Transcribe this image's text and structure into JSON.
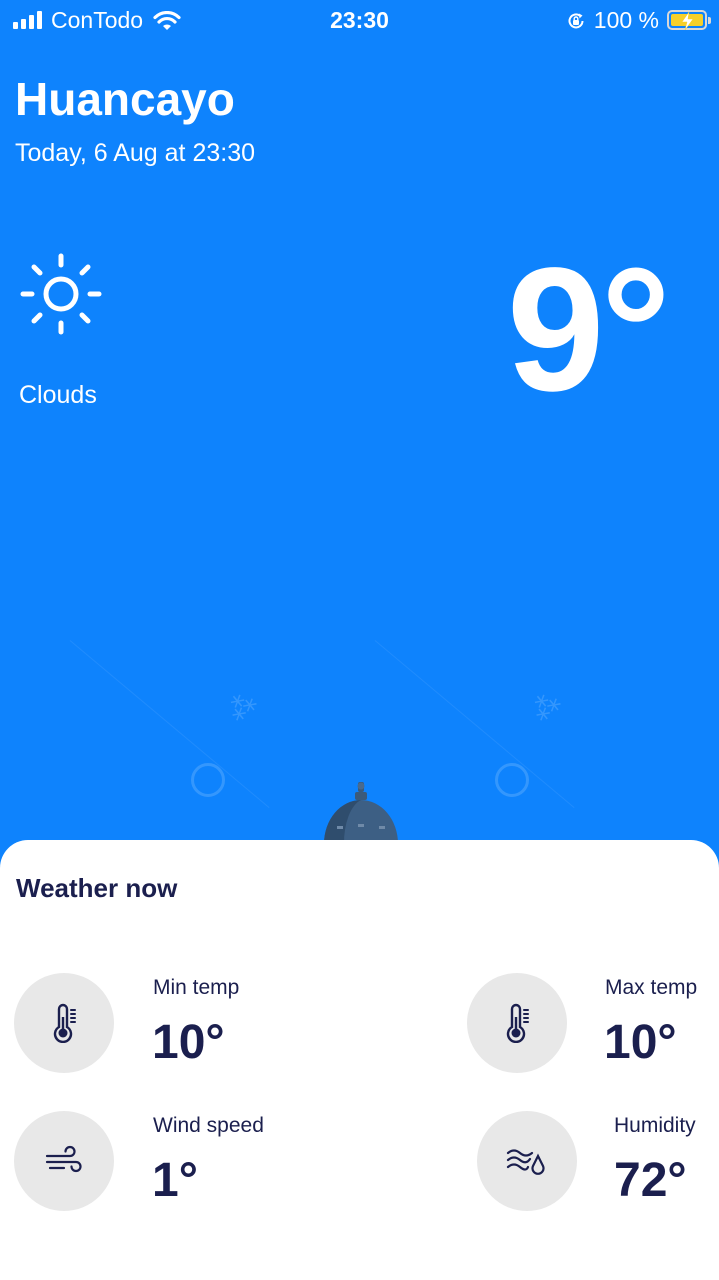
{
  "status_bar": {
    "carrier": "ConTodo",
    "time": "23:30",
    "battery_text": "100 %",
    "battery_level": 1.0,
    "icons": [
      "signal-icon",
      "wifi-icon",
      "rotation-lock-icon",
      "battery-charging-icon"
    ]
  },
  "location": {
    "city": "Huancayo",
    "date_line": "Today, 6 Aug at 23:30"
  },
  "current": {
    "condition": "Clouds",
    "temperature": "9°",
    "icon": "sun-icon"
  },
  "weather_now": {
    "title": "Weather now",
    "stats": [
      {
        "label": "Min temp",
        "value": "10°",
        "icon": "thermometer-icon"
      },
      {
        "label": "Max temp",
        "value": "10°",
        "icon": "thermometer-icon"
      },
      {
        "label": "Wind speed",
        "value": "1°",
        "icon": "wind-icon"
      },
      {
        "label": "Humidity",
        "value": "72°",
        "icon": "humidity-icon"
      }
    ]
  },
  "colors": {
    "background": "#0e83fd",
    "card": "#ffffff",
    "text_dark": "#1b1f4e",
    "circle": "#e8e8e8"
  }
}
